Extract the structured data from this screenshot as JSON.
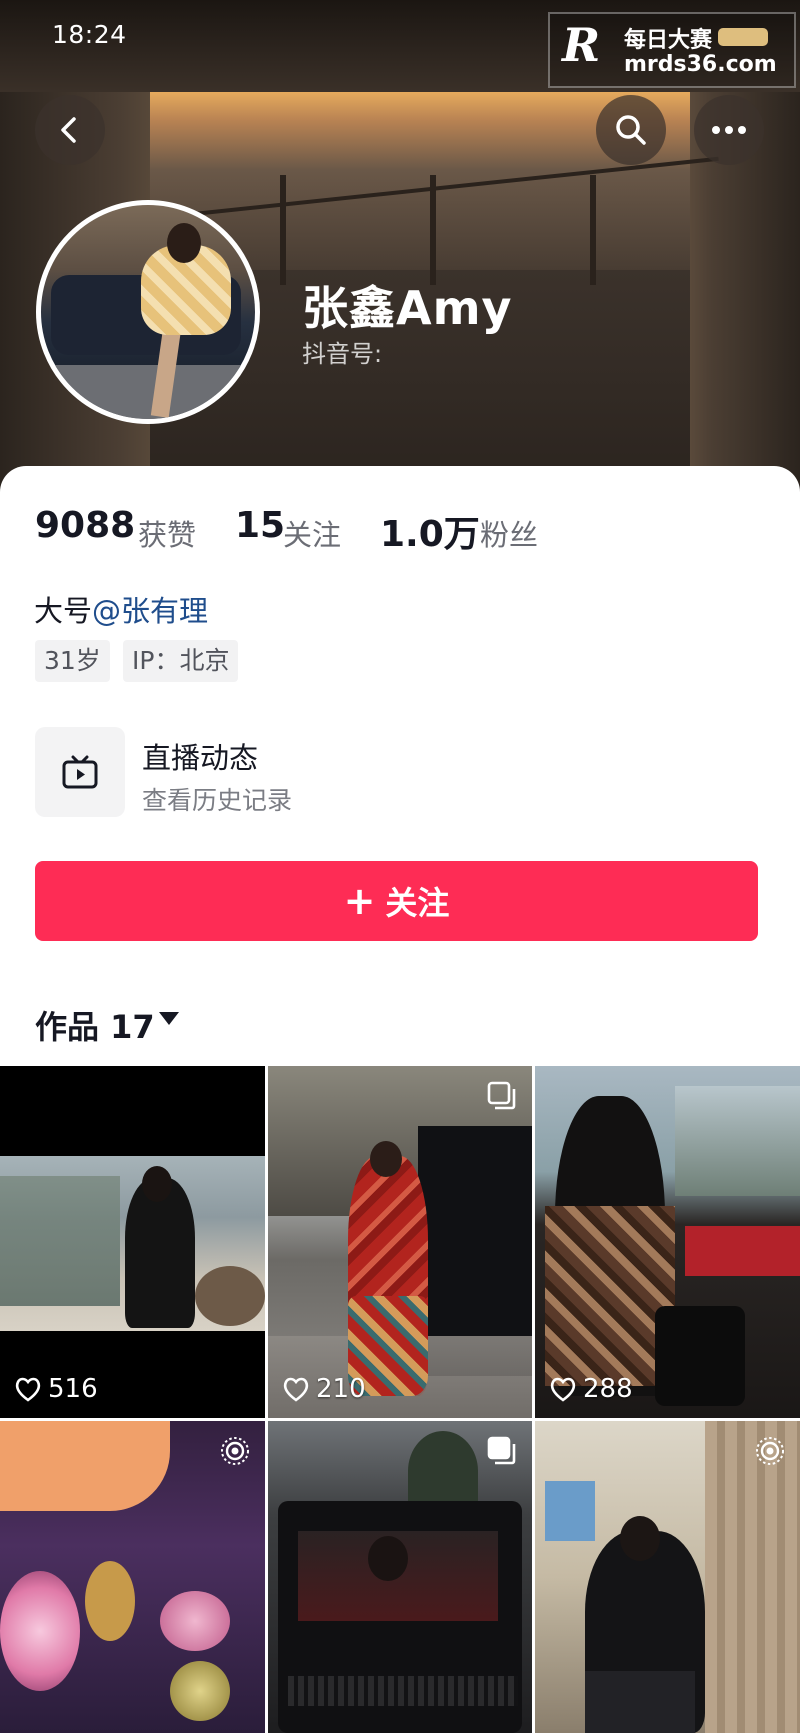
{
  "status_bar": {
    "time": "18:24"
  },
  "watermark": {
    "logo": "R",
    "title": "每日大赛",
    "url": "mrds36.com"
  },
  "header": {
    "back_icon": "chevron-left-icon",
    "search_icon": "search-icon",
    "more_icon": "more-dots-icon"
  },
  "profile": {
    "name": "张鑫Amy",
    "douyin_id_label": "抖音号:",
    "stats": [
      {
        "value": "9088",
        "label": "获赞"
      },
      {
        "value": "15",
        "label": "关注"
      },
      {
        "value": "1.0万",
        "label": "粉丝"
      }
    ],
    "bio_prefix": "大号",
    "bio_mention": "@张有理",
    "tags": [
      "31岁",
      "IP：北京"
    ],
    "live": {
      "title": "直播动态",
      "subtitle": "查看历史记录",
      "icon": "tv-icon"
    },
    "follow_button": {
      "plus": "+",
      "label": "关注"
    },
    "works": {
      "label": "作品 17"
    }
  },
  "grid": [
    {
      "likes": "516",
      "corner_icon": "",
      "bg": "photo-1"
    },
    {
      "likes": "210",
      "corner_icon": "multi-image-icon",
      "bg": "photo-2"
    },
    {
      "likes": "288",
      "corner_icon": "",
      "bg": "photo-3"
    },
    {
      "likes": "",
      "corner_icon": "live-photo-icon",
      "bg": "photo-4"
    },
    {
      "likes": "",
      "corner_icon": "multi-image-icon",
      "bg": "photo-5"
    },
    {
      "likes": "",
      "corner_icon": "live-photo-icon",
      "bg": "photo-6"
    }
  ],
  "colors": {
    "accent": "#fe2c55",
    "mention": "#1f4d8c",
    "text": "#161823"
  }
}
